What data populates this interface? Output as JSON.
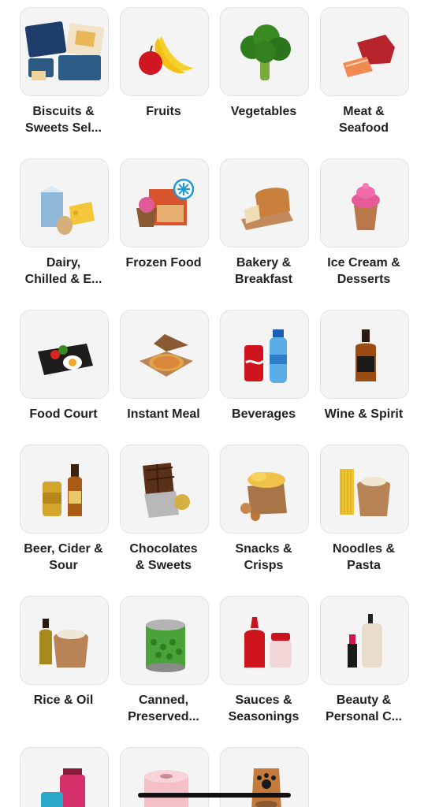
{
  "categories": [
    {
      "label": "Biscuits &\nSweets Sel...",
      "icon": "biscuit-gift-box-icon"
    },
    {
      "label": "Fruits",
      "icon": "fruit-icon"
    },
    {
      "label": "Vegetables",
      "icon": "broccoli-icon"
    },
    {
      "label": "Meat &\nSeafood",
      "icon": "meat-fish-icon"
    },
    {
      "label": "Dairy,\nChilled & E...",
      "icon": "dairy-icon"
    },
    {
      "label": "Frozen Food",
      "icon": "frozen-food-icon"
    },
    {
      "label": "Bakery &\nBreakfast",
      "icon": "bread-icon"
    },
    {
      "label": "Ice Cream &\nDesserts",
      "icon": "ice-cream-icon"
    },
    {
      "label": "Food Court",
      "icon": "meal-box-icon"
    },
    {
      "label": "Instant Meal",
      "icon": "pizza-box-icon"
    },
    {
      "label": "Beverages",
      "icon": "soda-water-icon"
    },
    {
      "label": "Wine & Spirit",
      "icon": "whisky-bottle-icon"
    },
    {
      "label": "Beer, Cider &\nSour",
      "icon": "beer-icon"
    },
    {
      "label": "Chocolates\n& Sweets",
      "icon": "chocolate-icon"
    },
    {
      "label": "Snacks &\nCrisps",
      "icon": "chips-icon"
    },
    {
      "label": "Noodles &\nPasta",
      "icon": "pasta-icon"
    },
    {
      "label": "Rice & Oil",
      "icon": "rice-oil-icon"
    },
    {
      "label": "Canned,\nPreserved...",
      "icon": "canned-peas-icon"
    },
    {
      "label": "Sauces &\nSeasonings",
      "icon": "sauce-bottle-icon"
    },
    {
      "label": "Beauty &\nPersonal C...",
      "icon": "beauty-icon"
    },
    {
      "label": "",
      "icon": "supplements-icon"
    },
    {
      "label": "",
      "icon": "tissue-roll-icon"
    },
    {
      "label": "",
      "icon": "pet-food-icon"
    }
  ]
}
